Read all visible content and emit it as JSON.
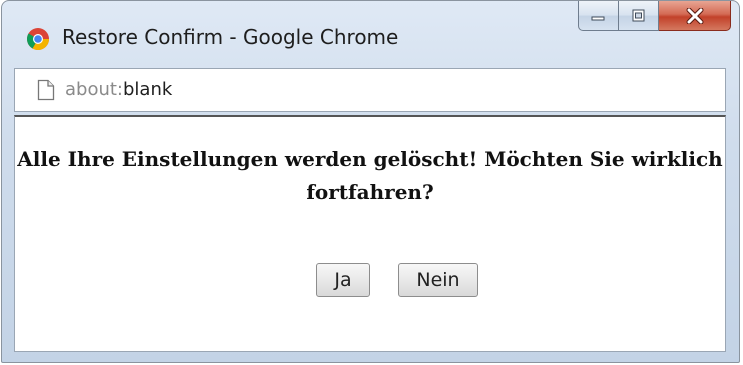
{
  "window": {
    "title": "Restore Confirm - Google Chrome",
    "close_label": "X"
  },
  "address_bar": {
    "url_scheme": "about:",
    "url_path": "blank"
  },
  "dialog": {
    "message": "Alle Ihre Einstellungen werden gelöscht! Möchten Sie wirklich fortfahren?",
    "yes_label": "Ja",
    "no_label": "Nein"
  },
  "icons": {
    "app": "chrome-logo-icon",
    "page": "blank-page-icon",
    "minimize": "minimize-icon",
    "maximize": "maximize-icon",
    "close": "close-icon"
  },
  "colors": {
    "titlebar": "#cfdcec",
    "close_button": "#c2412a"
  }
}
